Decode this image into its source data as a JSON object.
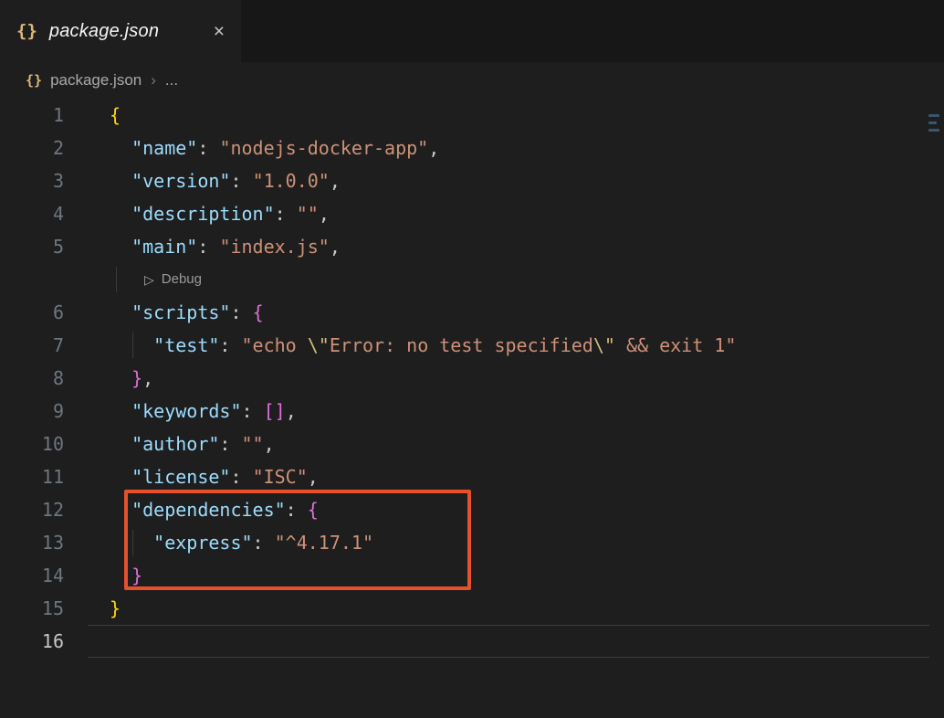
{
  "colors": {
    "background": "#1e1e1e",
    "tab_strip": "#171717",
    "json_icon": "#dcb67a",
    "key": "#9cdcfe",
    "str": "#ce9178",
    "esc": "#d7ba7d",
    "punc": "#cccccc",
    "b1": "#ffd700",
    "b2": "#da70d6",
    "lineno": "#6e7681",
    "lineno_active": "#c6c6c6",
    "codelens": "#999999",
    "annotation": "#e8502c",
    "minimap_mark": "rgba(86,156,214,0.45)"
  },
  "tab": {
    "icon": "{}",
    "title": "package.json",
    "close_glyph": "×"
  },
  "breadcrumb": {
    "icon": "{}",
    "file": "package.json",
    "separator": "›",
    "ellipsis": "..."
  },
  "editor": {
    "codelens": {
      "icon": "▷",
      "label": "Debug"
    },
    "rows": [
      {
        "num": "1",
        "tokens": [
          {
            "t": "{",
            "c": "b1"
          }
        ]
      },
      {
        "num": "2",
        "tokens": [
          {
            "t": "  "
          },
          {
            "t": "\"name\"",
            "c": "key"
          },
          {
            "t": ": ",
            "c": "punc"
          },
          {
            "t": "\"nodejs-docker-app\"",
            "c": "str"
          },
          {
            "t": ",",
            "c": "punc"
          }
        ]
      },
      {
        "num": "3",
        "tokens": [
          {
            "t": "  "
          },
          {
            "t": "\"version\"",
            "c": "key"
          },
          {
            "t": ": ",
            "c": "punc"
          },
          {
            "t": "\"1.0.0\"",
            "c": "str"
          },
          {
            "t": ",",
            "c": "punc"
          }
        ]
      },
      {
        "num": "4",
        "tokens": [
          {
            "t": "  "
          },
          {
            "t": "\"description\"",
            "c": "key"
          },
          {
            "t": ": ",
            "c": "punc"
          },
          {
            "t": "\"\"",
            "c": "str"
          },
          {
            "t": ",",
            "c": "punc"
          }
        ]
      },
      {
        "num": "5",
        "tokens": [
          {
            "t": "  "
          },
          {
            "t": "\"main\"",
            "c": "key"
          },
          {
            "t": ": ",
            "c": "punc"
          },
          {
            "t": "\"index.js\"",
            "c": "str"
          },
          {
            "t": ",",
            "c": "punc"
          }
        ]
      },
      {
        "codelens": true
      },
      {
        "num": "6",
        "tokens": [
          {
            "t": "  "
          },
          {
            "t": "\"scripts\"",
            "c": "key"
          },
          {
            "t": ": ",
            "c": "punc"
          },
          {
            "t": "{",
            "c": "b2"
          }
        ]
      },
      {
        "num": "7",
        "tokens": [
          {
            "t": "    "
          },
          {
            "t": "\"test\"",
            "c": "key"
          },
          {
            "t": ": ",
            "c": "punc"
          },
          {
            "t": "\"echo ",
            "c": "str"
          },
          {
            "t": "\\\"",
            "c": "esc"
          },
          {
            "t": "Error: no test specified",
            "c": "str"
          },
          {
            "t": "\\\"",
            "c": "esc"
          },
          {
            "t": " && exit 1\"",
            "c": "str"
          }
        ]
      },
      {
        "num": "8",
        "tokens": [
          {
            "t": "  "
          },
          {
            "t": "}",
            "c": "b2"
          },
          {
            "t": ",",
            "c": "punc"
          }
        ]
      },
      {
        "num": "9",
        "tokens": [
          {
            "t": "  "
          },
          {
            "t": "\"keywords\"",
            "c": "key"
          },
          {
            "t": ": ",
            "c": "punc"
          },
          {
            "t": "[]",
            "c": "b2"
          },
          {
            "t": ",",
            "c": "punc"
          }
        ]
      },
      {
        "num": "10",
        "tokens": [
          {
            "t": "  "
          },
          {
            "t": "\"author\"",
            "c": "key"
          },
          {
            "t": ": ",
            "c": "punc"
          },
          {
            "t": "\"\"",
            "c": "str"
          },
          {
            "t": ",",
            "c": "punc"
          }
        ]
      },
      {
        "num": "11",
        "tokens": [
          {
            "t": "  "
          },
          {
            "t": "\"license\"",
            "c": "key"
          },
          {
            "t": ": ",
            "c": "punc"
          },
          {
            "t": "\"ISC\"",
            "c": "str"
          },
          {
            "t": ",",
            "c": "punc"
          }
        ]
      },
      {
        "num": "12",
        "tokens": [
          {
            "t": "  "
          },
          {
            "t": "\"dependencies\"",
            "c": "key"
          },
          {
            "t": ": ",
            "c": "punc"
          },
          {
            "t": "{",
            "c": "b2"
          }
        ]
      },
      {
        "num": "13",
        "tokens": [
          {
            "t": "    "
          },
          {
            "t": "\"express\"",
            "c": "key"
          },
          {
            "t": ": ",
            "c": "punc"
          },
          {
            "t": "\"^4.17.1\"",
            "c": "str"
          }
        ]
      },
      {
        "num": "14",
        "tokens": [
          {
            "t": "  "
          },
          {
            "t": "}",
            "c": "b2"
          }
        ]
      },
      {
        "num": "15",
        "tokens": [
          {
            "t": "}",
            "c": "b1"
          }
        ]
      },
      {
        "num": "16",
        "tokens": [],
        "current": true
      }
    ]
  }
}
